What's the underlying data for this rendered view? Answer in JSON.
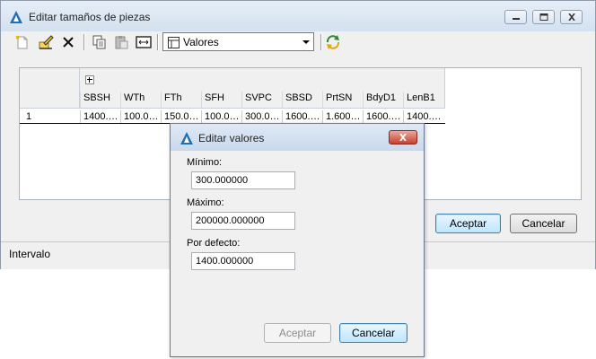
{
  "window": {
    "title": "Editar tamaños de piezas",
    "combo_value": "Valores",
    "accept_label": "Aceptar",
    "cancel_label": "Cancelar",
    "status_text": "Intervalo"
  },
  "grid": {
    "columns": [
      "SBSH",
      "WTh",
      "FTh",
      "SFH",
      "SVPC",
      "SBSD",
      "PrtSN",
      "BdyD1",
      "LenB1"
    ],
    "rows": [
      {
        "num": "1",
        "cells": [
          "1400.…",
          "100.0…",
          "150.0…",
          "100.0…",
          "300.0…",
          "1600.…",
          "1.600…",
          "1600.…",
          "1400.…"
        ]
      }
    ]
  },
  "dialog": {
    "title": "Editar valores",
    "min_label": "Mínimo:",
    "min_value": "300.000000",
    "max_label": "Máximo:",
    "max_value": "200000.000000",
    "default_label": "Por defecto:",
    "default_value": "1400.000000",
    "accept_label": "Aceptar",
    "cancel_label": "Cancelar"
  },
  "colors": {
    "accent": "#1e6fb8",
    "title_bg": "#dbe6f2",
    "close_red": "#c7412d"
  },
  "icons": [
    "app-icon",
    "minimize-icon",
    "maximize-icon",
    "close-icon",
    "new-icon",
    "edit-icon",
    "delete-icon",
    "copy-icon",
    "paste-icon",
    "resize-icon",
    "table-icon",
    "refresh-icon"
  ]
}
